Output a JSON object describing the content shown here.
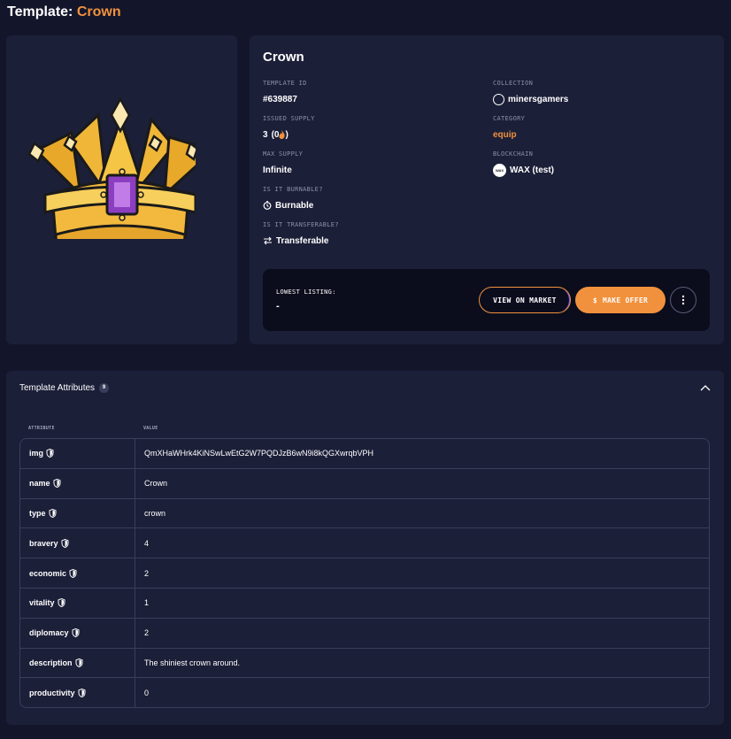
{
  "page": {
    "title_prefix": "Template:",
    "title_name": "Crown"
  },
  "info": {
    "title": "Crown",
    "template_id_label": "TEMPLATE ID",
    "template_id": "#639887",
    "collection_label": "COLLECTION",
    "collection": "minersgamers",
    "issued_supply_label": "ISSUED SUPPLY",
    "issued_supply": "3",
    "issued_burned": "(0",
    "issued_burned_close": ")",
    "category_label": "CATEGORY",
    "category": "equip",
    "max_supply_label": "MAX SUPPLY",
    "max_supply": "Infinite",
    "blockchain_label": "BLOCKCHAIN",
    "blockchain": "WAX (test)",
    "blockchain_badge": "WAX",
    "burnable_label": "IS IT BURNABLE?",
    "burnable": "Burnable",
    "transferable_label": "IS IT TRANSFERABLE?",
    "transferable": "Transferable"
  },
  "listing": {
    "label": "LOWEST LISTING:",
    "value": "-",
    "market_button": "VIEW ON MARKET",
    "offer_button": "MAKE OFFER",
    "offer_icon": "$"
  },
  "attributes": {
    "header": "Template Attributes",
    "count": "9",
    "col_attribute": "ATTRIBUTE",
    "col_value": "VALUE",
    "rows": [
      {
        "key": "img",
        "value": "QmXHaWHrk4KiNSwLwEtG2W7PQDJzB6wN9i8kQGXwrqbVPH"
      },
      {
        "key": "name",
        "value": "Crown"
      },
      {
        "key": "type",
        "value": "crown"
      },
      {
        "key": "bravery",
        "value": "4"
      },
      {
        "key": "economic",
        "value": "2"
      },
      {
        "key": "vitality",
        "value": "1"
      },
      {
        "key": "diplomacy",
        "value": "2"
      },
      {
        "key": "description",
        "value": "The shiniest crown around."
      },
      {
        "key": "productivity",
        "value": "0"
      }
    ]
  },
  "colors": {
    "background": "#13162b",
    "card": "#1c1f38",
    "accent": "#f2913d",
    "listing_box": "#0b0d1d"
  }
}
